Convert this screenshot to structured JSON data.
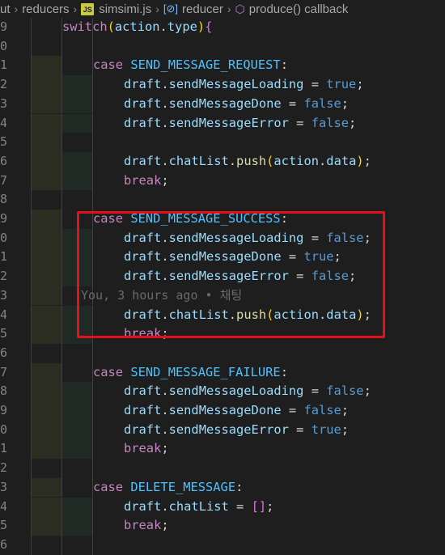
{
  "breadcrumb": {
    "items": [
      "ut",
      "reducers",
      "simsimi.js",
      "reducer",
      "produce() callback"
    ],
    "file_badge": "JS",
    "separator": "›"
  },
  "blame": "You, 3 hours ago • 채팅",
  "lines": [
    {
      "n": "9",
      "indent": 1,
      "tokens": [
        [
          "kw-c",
          "switch"
        ],
        [
          "br",
          "("
        ],
        [
          "id",
          "action"
        ],
        [
          "punc",
          "."
        ],
        [
          "id",
          "type"
        ],
        [
          "br",
          ")"
        ],
        [
          "br2",
          "{"
        ]
      ]
    },
    {
      "n": "0",
      "indent": 1,
      "tokens": []
    },
    {
      "n": "1",
      "indent": 2,
      "tokens": [
        [
          "kw-c",
          "case"
        ],
        [
          "punc",
          " "
        ],
        [
          "cons",
          "SEND_MESSAGE_REQUEST"
        ],
        [
          "punc",
          ":"
        ]
      ]
    },
    {
      "n": "2",
      "indent": 3,
      "tokens": [
        [
          "id",
          "draft"
        ],
        [
          "punc",
          "."
        ],
        [
          "id",
          "sendMessageLoading"
        ],
        [
          "punc",
          " = "
        ],
        [
          "kw-b",
          "true"
        ],
        [
          "punc",
          ";"
        ]
      ]
    },
    {
      "n": "3",
      "indent": 3,
      "tokens": [
        [
          "id",
          "draft"
        ],
        [
          "punc",
          "."
        ],
        [
          "id",
          "sendMessageDone"
        ],
        [
          "punc",
          " = "
        ],
        [
          "kw-b",
          "false"
        ],
        [
          "punc",
          ";"
        ]
      ]
    },
    {
      "n": "4",
      "indent": 3,
      "tokens": [
        [
          "id",
          "draft"
        ],
        [
          "punc",
          "."
        ],
        [
          "id",
          "sendMessageError"
        ],
        [
          "punc",
          " = "
        ],
        [
          "kw-b",
          "false"
        ],
        [
          "punc",
          ";"
        ]
      ]
    },
    {
      "n": "5",
      "indent": 2,
      "tokens": []
    },
    {
      "n": "6",
      "indent": 3,
      "tokens": [
        [
          "id",
          "draft"
        ],
        [
          "punc",
          "."
        ],
        [
          "id",
          "chatList"
        ],
        [
          "punc",
          "."
        ],
        [
          "fn",
          "push"
        ],
        [
          "br",
          "("
        ],
        [
          "id",
          "action"
        ],
        [
          "punc",
          "."
        ],
        [
          "id",
          "data"
        ],
        [
          "br",
          ")"
        ],
        [
          "punc",
          ";"
        ]
      ]
    },
    {
      "n": "7",
      "indent": 3,
      "tokens": [
        [
          "kw-c",
          "break"
        ],
        [
          "punc",
          ";"
        ]
      ]
    },
    {
      "n": "8",
      "indent": 1,
      "tokens": []
    },
    {
      "n": "9",
      "indent": 2,
      "tokens": [
        [
          "kw-c",
          "case"
        ],
        [
          "punc",
          " "
        ],
        [
          "cons",
          "SEND_MESSAGE_SUCCESS"
        ],
        [
          "punc",
          ":"
        ]
      ]
    },
    {
      "n": "0",
      "indent": 3,
      "tokens": [
        [
          "id",
          "draft"
        ],
        [
          "punc",
          "."
        ],
        [
          "id",
          "sendMessageLoading"
        ],
        [
          "punc",
          " = "
        ],
        [
          "kw-b",
          "false"
        ],
        [
          "punc",
          ";"
        ]
      ]
    },
    {
      "n": "1",
      "indent": 3,
      "tokens": [
        [
          "id",
          "draft"
        ],
        [
          "punc",
          "."
        ],
        [
          "id",
          "sendMessageDone"
        ],
        [
          "punc",
          " = "
        ],
        [
          "kw-b",
          "true"
        ],
        [
          "punc",
          ";"
        ]
      ]
    },
    {
      "n": "2",
      "indent": 3,
      "tokens": [
        [
          "id",
          "draft"
        ],
        [
          "punc",
          "."
        ],
        [
          "id",
          "sendMessageError"
        ],
        [
          "punc",
          " = "
        ],
        [
          "kw-b",
          "false"
        ],
        [
          "punc",
          ";"
        ]
      ]
    },
    {
      "n": "3",
      "indent": 0,
      "blame": true,
      "tokens": []
    },
    {
      "n": "4",
      "indent": 3,
      "tokens": [
        [
          "id",
          "draft"
        ],
        [
          "punc",
          "."
        ],
        [
          "id",
          "chatList"
        ],
        [
          "punc",
          "."
        ],
        [
          "fn",
          "push"
        ],
        [
          "br",
          "("
        ],
        [
          "id",
          "action"
        ],
        [
          "punc",
          "."
        ],
        [
          "id",
          "data"
        ],
        [
          "br",
          ")"
        ],
        [
          "punc",
          ";"
        ]
      ]
    },
    {
      "n": "5",
      "indent": 3,
      "tokens": [
        [
          "kw-c",
          "break"
        ],
        [
          "punc",
          ";"
        ]
      ]
    },
    {
      "n": "6",
      "indent": 1,
      "tokens": []
    },
    {
      "n": "7",
      "indent": 2,
      "tokens": [
        [
          "kw-c",
          "case"
        ],
        [
          "punc",
          " "
        ],
        [
          "cons",
          "SEND_MESSAGE_FAILURE"
        ],
        [
          "punc",
          ":"
        ]
      ]
    },
    {
      "n": "8",
      "indent": 3,
      "tokens": [
        [
          "id",
          "draft"
        ],
        [
          "punc",
          "."
        ],
        [
          "id",
          "sendMessageLoading"
        ],
        [
          "punc",
          " = "
        ],
        [
          "kw-b",
          "false"
        ],
        [
          "punc",
          ";"
        ]
      ]
    },
    {
      "n": "9",
      "indent": 3,
      "tokens": [
        [
          "id",
          "draft"
        ],
        [
          "punc",
          "."
        ],
        [
          "id",
          "sendMessageDone"
        ],
        [
          "punc",
          " = "
        ],
        [
          "kw-b",
          "false"
        ],
        [
          "punc",
          ";"
        ]
      ]
    },
    {
      "n": "0",
      "indent": 3,
      "tokens": [
        [
          "id",
          "draft"
        ],
        [
          "punc",
          "."
        ],
        [
          "id",
          "sendMessageError"
        ],
        [
          "punc",
          " = "
        ],
        [
          "kw-b",
          "true"
        ],
        [
          "punc",
          ";"
        ]
      ]
    },
    {
      "n": "1",
      "indent": 3,
      "tokens": [
        [
          "kw-c",
          "break"
        ],
        [
          "punc",
          ";"
        ]
      ]
    },
    {
      "n": "2",
      "indent": 1,
      "tokens": []
    },
    {
      "n": "3",
      "indent": 2,
      "tokens": [
        [
          "kw-c",
          "case"
        ],
        [
          "punc",
          " "
        ],
        [
          "cons",
          "DELETE_MESSAGE"
        ],
        [
          "punc",
          ":"
        ]
      ]
    },
    {
      "n": "4",
      "indent": 3,
      "tokens": [
        [
          "id",
          "draft"
        ],
        [
          "punc",
          "."
        ],
        [
          "id",
          "chatList"
        ],
        [
          "punc",
          " = "
        ],
        [
          "br2",
          "[]"
        ],
        [
          "punc",
          ";"
        ]
      ]
    },
    {
      "n": "5",
      "indent": 3,
      "tokens": [
        [
          "kw-c",
          "break"
        ],
        [
          "punc",
          ";"
        ]
      ]
    },
    {
      "n": "6",
      "indent": 1,
      "tokens": []
    }
  ],
  "colors": {
    "background": "#1e1e1e",
    "highlight_box": "#e6101a",
    "keyword_control": "#c586c0",
    "keyword_literal": "#569cd6",
    "identifier": "#9cdcfe",
    "constant": "#4fc1ff",
    "function": "#dcdcaa"
  }
}
